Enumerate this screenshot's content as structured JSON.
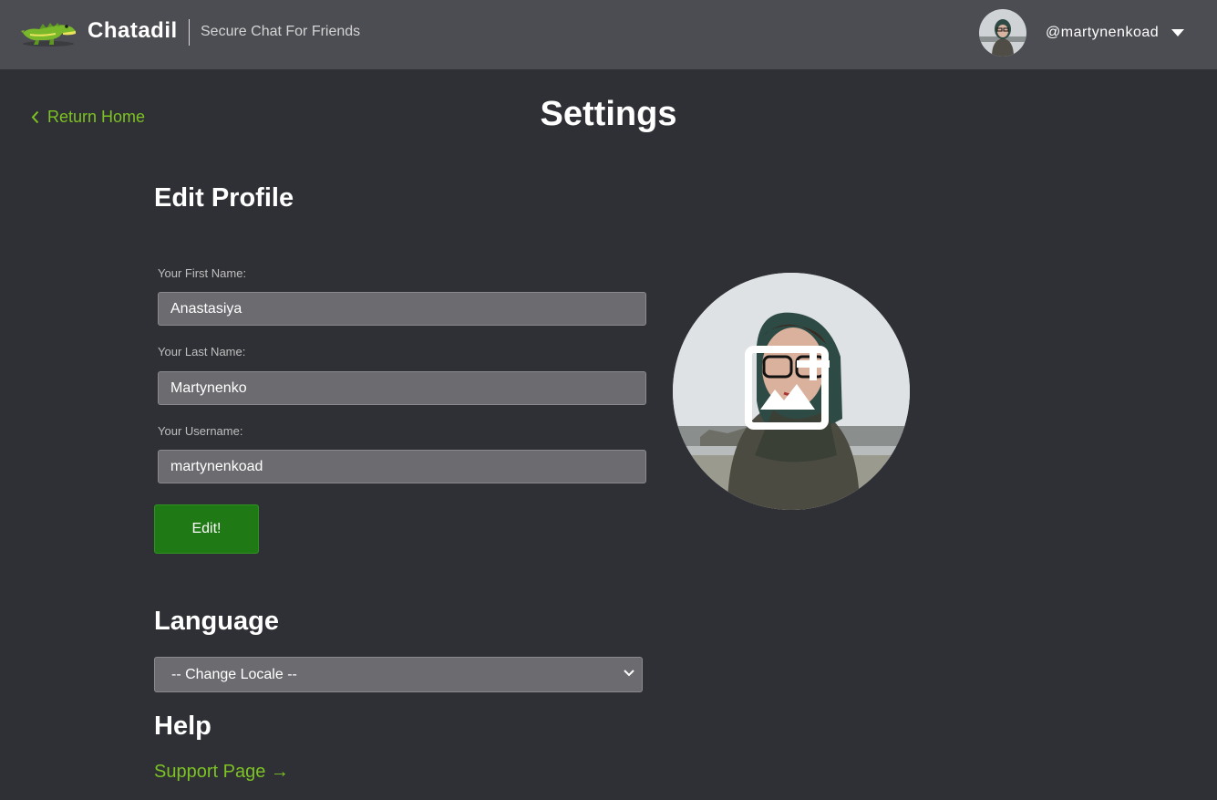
{
  "header": {
    "brand": "Chatadil",
    "tagline": "Secure Chat For Friends",
    "username": "@martynenkoad"
  },
  "nav": {
    "return_home": "Return Home"
  },
  "page_title": "Settings",
  "edit_profile": {
    "title": "Edit Profile",
    "first_name_label": "Your First Name:",
    "first_name_value": "Anastasiya",
    "last_name_label": "Your Last Name:",
    "last_name_value": "Martynenko",
    "username_label": "Your Username:",
    "username_value": "martynenkoad",
    "edit_button": "Edit!"
  },
  "language": {
    "title": "Language",
    "selected": "-- Change Locale --"
  },
  "help": {
    "title": "Help",
    "support_link": "Support Page →"
  },
  "colors": {
    "header_bg": "#4c4d52",
    "page_bg": "#2f3035",
    "accent_green": "#7cc223",
    "button_green": "#1f7a15",
    "input_bg": "#6b6b70"
  },
  "icons": {
    "logo": "crocodile-logo",
    "back": "chevron-left-icon",
    "menu": "caret-down-icon",
    "upload": "add-image-icon",
    "select": "chevron-down-icon"
  }
}
